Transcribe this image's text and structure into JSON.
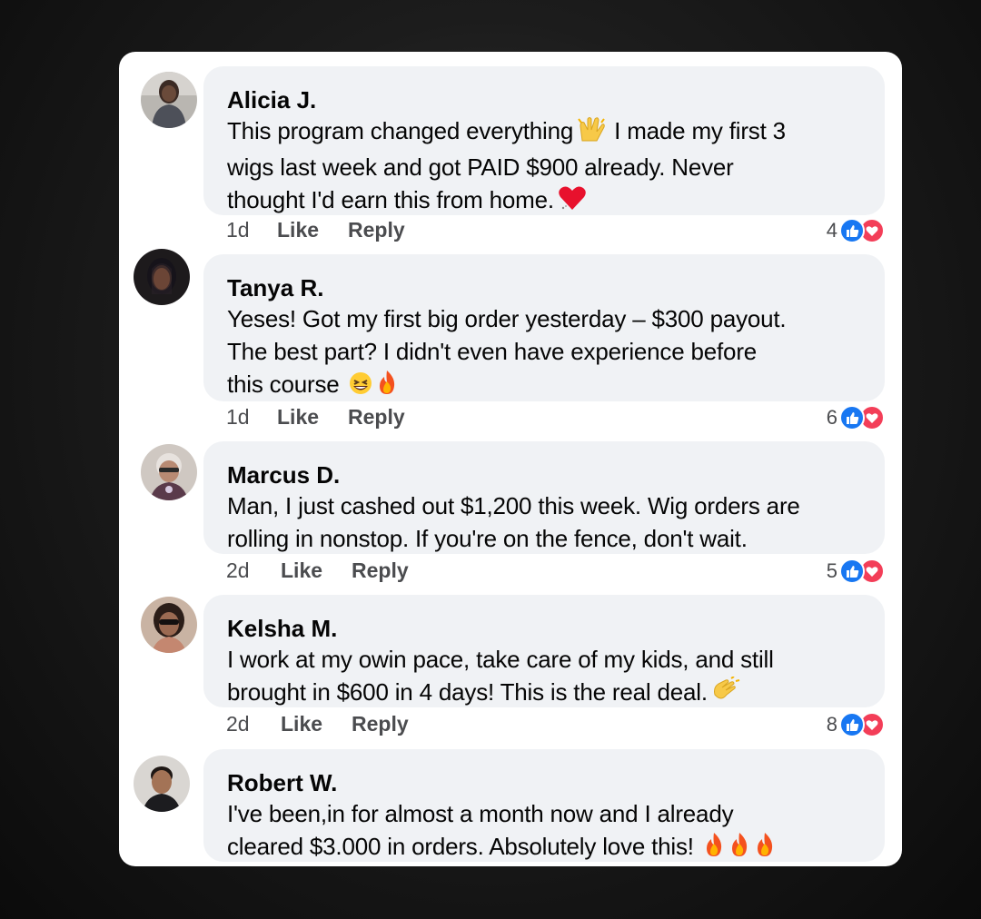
{
  "comments": [
    {
      "author": "Alicia J.",
      "text": "This program changed everything",
      "text_after_emoji": " I made my first 3\nwigs last week and got PAID $900 already. Never\nthought I'd earn this from home.",
      "emoji_1": "raising-hands-emoji",
      "emoji_2": "heart-emoji",
      "time": "1d",
      "like": "Like",
      "reply": "Reply",
      "reaction_count": "4",
      "avatar_color": "#6b6f78"
    },
    {
      "author": "Tanya R.",
      "text": "Yeses! Got my first big order yesterday – $300 payout.\nThe best part? I didn't even have experience before\nthis course",
      "emoji_1": "grinning-squint-emoji",
      "emoji_2": "fire-emoji",
      "time": "1d",
      "like": "Like",
      "reply": "Reply",
      "reaction_count": "6",
      "avatar_color": "#2f2a2e"
    },
    {
      "author": "Marcus D.",
      "text": "Man, I just cashed out $1,200 this week. Wig orders are\nrolling in nonstop. If you're on the fence, don't wait.",
      "time": "2d",
      "like": "Like",
      "reply": "Reply",
      "reaction_count": "5",
      "avatar_color": "#9a8d86"
    },
    {
      "author": "Kelsha M.",
      "text": "I work at my owin pace, take care of my kids, and still\nbrought in $600 in 4 days! This is the real deal.",
      "emoji_1": "clapping-hands-emoji",
      "time": "2d",
      "like": "Like",
      "reply": "Reply",
      "reaction_count": "8",
      "avatar_color": "#8c6a5a"
    },
    {
      "author": "Robert W.",
      "text": "I've been,in for almost a month now and I already\ncleared $3.000 in orders. Absolutely love this!",
      "emoji_1": "fire-emoji",
      "time": "",
      "avatar_color": "#7a5a48"
    }
  ],
  "colors": {
    "bubble": "#f0f2f5",
    "like_blue": "#1877f2",
    "love_red": "#f33e58",
    "text": "#050505"
  }
}
